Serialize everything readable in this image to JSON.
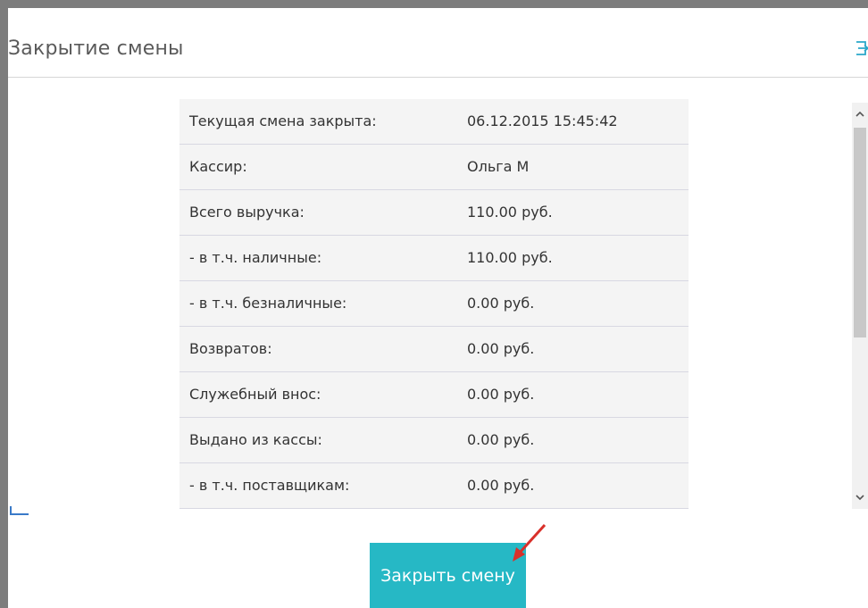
{
  "dialog": {
    "title": "Закрытие смены",
    "exit_icon": "exit-icon"
  },
  "shift_table": {
    "rows": [
      {
        "label": "Текущая смена закрыта:",
        "value": "06.12.2015 15:45:42"
      },
      {
        "label": "Кассир:",
        "value": "Ольга М"
      },
      {
        "label": "Всего выручка:",
        "value": "110.00 руб."
      },
      {
        "label": "- в т.ч. наличные:",
        "value": "110.00 руб."
      },
      {
        "label": "- в т.ч. безналичные:",
        "value": "0.00 руб."
      },
      {
        "label": "Возвратов:",
        "value": "0.00 руб."
      },
      {
        "label": "Служебный внос:",
        "value": "0.00 руб."
      },
      {
        "label": "Выдано из кассы:",
        "value": "0.00 руб."
      },
      {
        "label": "- в т.ч. поставщикам:",
        "value": "0.00 руб."
      }
    ]
  },
  "actions": {
    "close_shift_label": "Закрыть смену"
  },
  "colors": {
    "button": "#26b8c5",
    "annotation_arrow": "#d9302a",
    "frame": "#7d7d7d",
    "row_bg": "#f4f4f4"
  }
}
